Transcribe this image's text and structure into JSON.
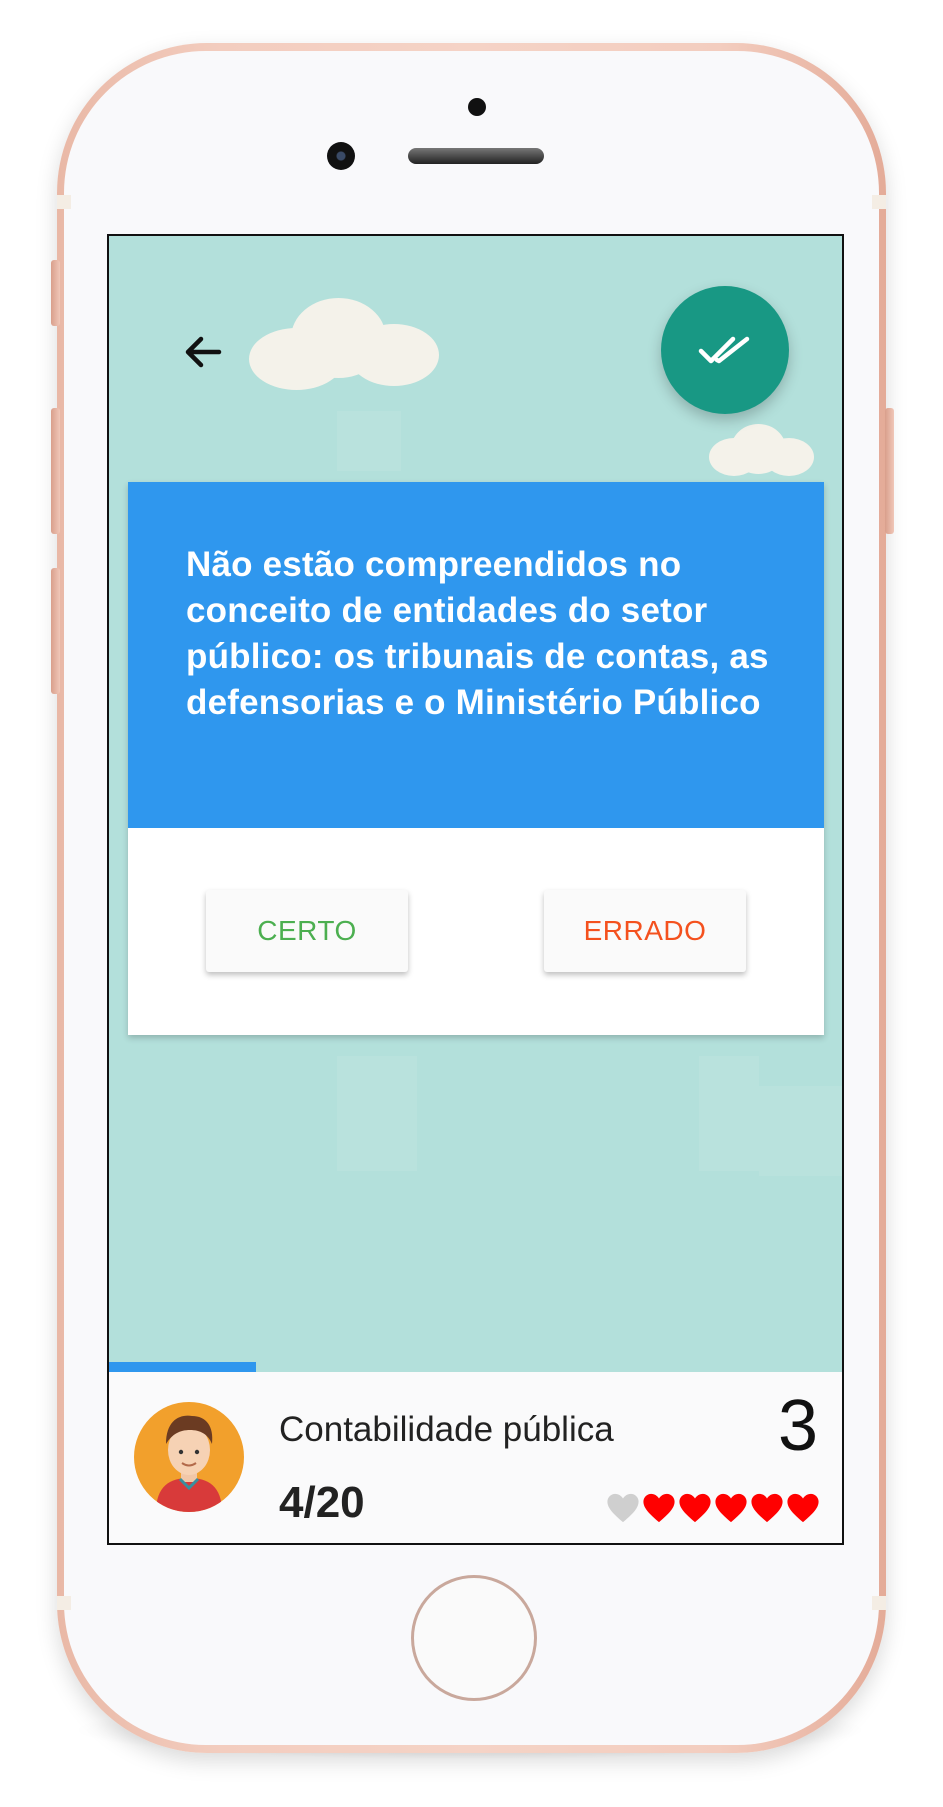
{
  "question": {
    "text": "Não estão compreendidos no conceito de entidades do setor público: os tribunais de contas, as defensorias e o Ministério Público"
  },
  "answers": {
    "true_label": "CERTO",
    "false_label": "ERRADO"
  },
  "footer": {
    "topic": "Contabilidade pública",
    "counter": "4/20",
    "score": "3",
    "progress": 0.2,
    "hearts_total": 6,
    "hearts_filled": 5
  },
  "icons": {
    "back": "arrow-left-icon",
    "fab": "double-check-icon",
    "hearts": "heart-icon"
  },
  "colors": {
    "screen_bg": "#b3e0db",
    "card_header": "#2f97ee",
    "fab": "#189884",
    "certo": "#4caf50",
    "errado": "#f4511e",
    "heart_on": "#ff0000",
    "heart_off": "#cfcfcf"
  }
}
